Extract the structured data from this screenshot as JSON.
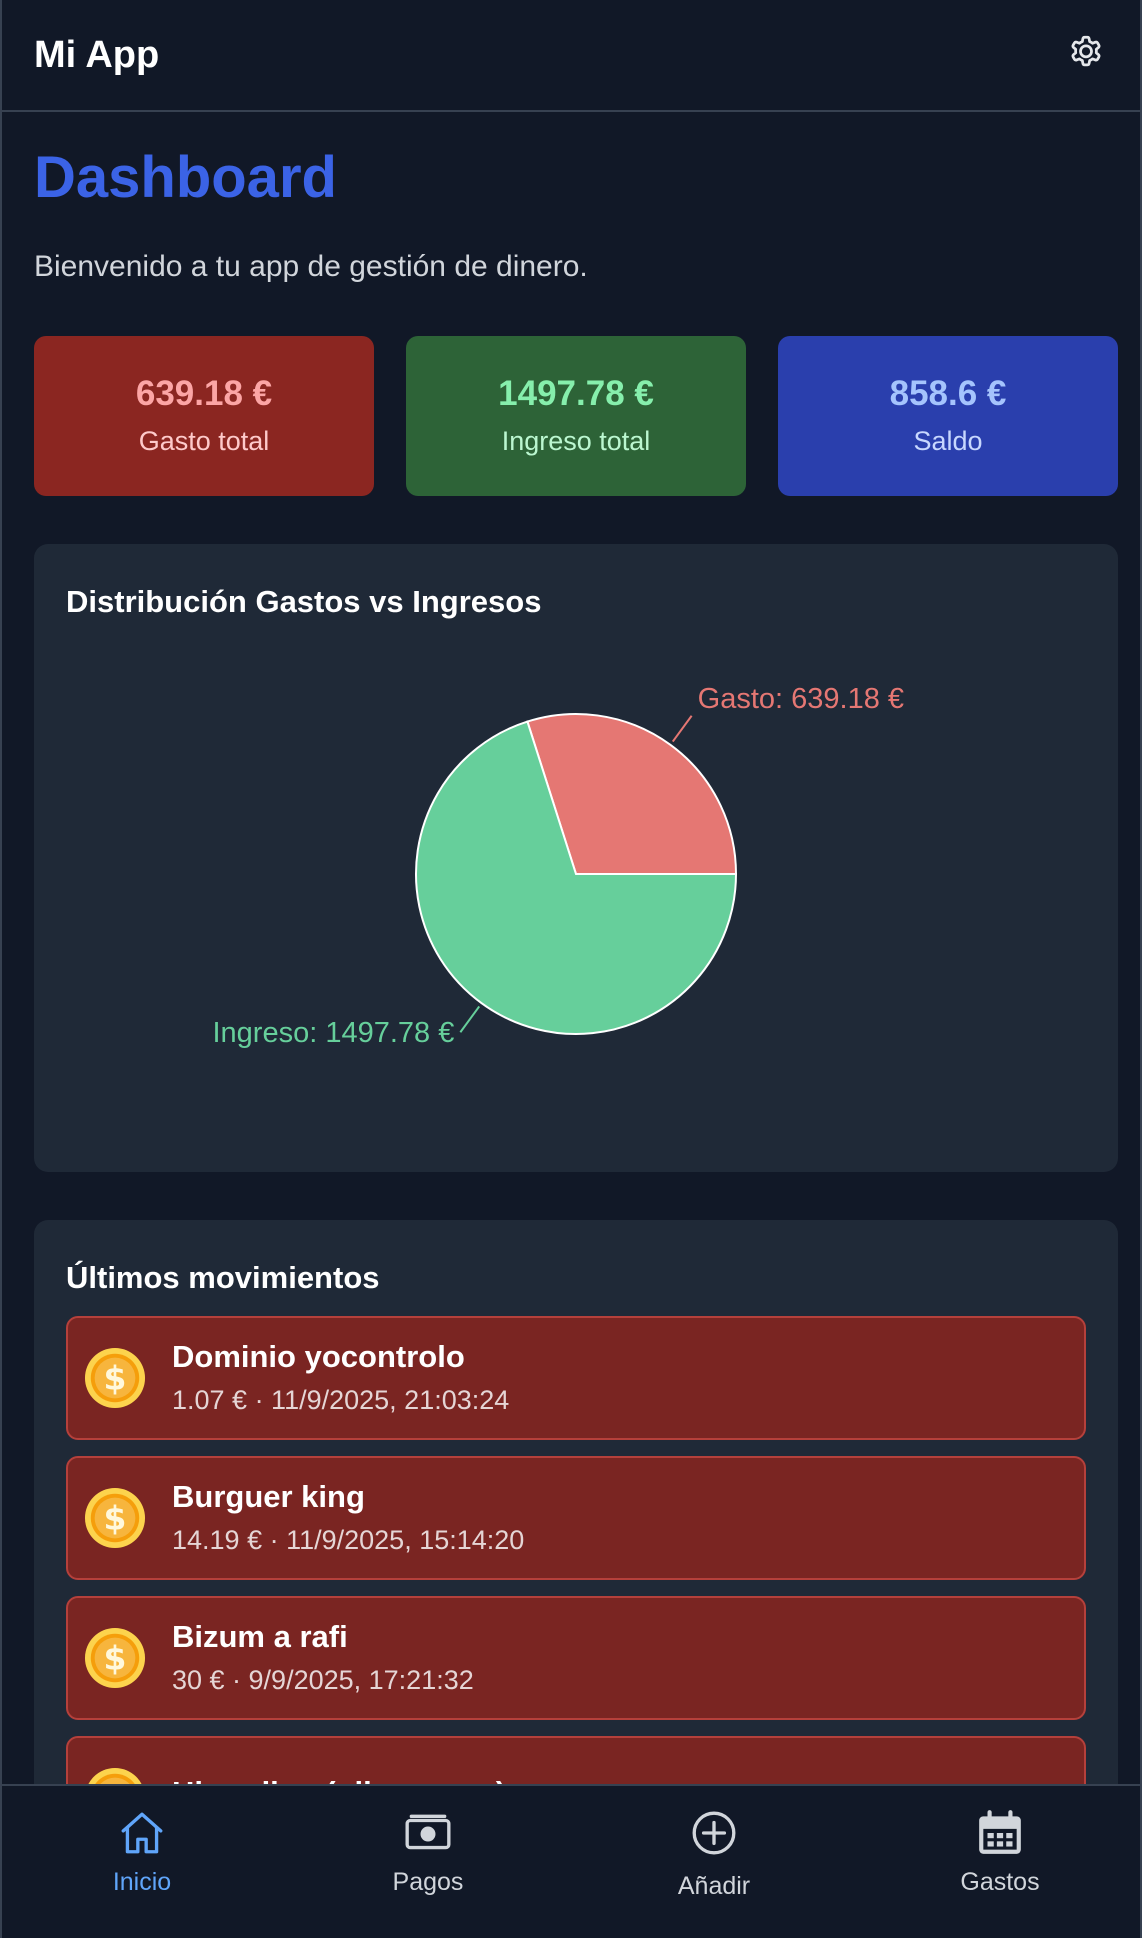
{
  "header": {
    "title": "Mi App",
    "settings_icon": "gear-icon"
  },
  "page": {
    "title": "Dashboard",
    "subtitle": "Bienvenido a tu app de gestión de dinero."
  },
  "stats": [
    {
      "value": "639.18 €",
      "label": "Gasto total",
      "color": "#8b2621"
    },
    {
      "value": "1497.78 €",
      "label": "Ingreso total",
      "color": "#2d6337"
    },
    {
      "value": "858.6 €",
      "label": "Saldo",
      "color": "#2a3fad"
    }
  ],
  "chart_card": {
    "title": "Distribución Gastos vs Ingresos"
  },
  "chart_data": {
    "type": "pie",
    "title": "",
    "slices": [
      {
        "label": "Gasto",
        "value": 639.18,
        "display": "Gasto: 639.18 €",
        "color": "#e57773"
      },
      {
        "label": "Ingreso",
        "value": 1497.78,
        "display": "Ingreso: 1497.78 €",
        "color": "#66cf9b"
      }
    ]
  },
  "movements": {
    "title": "Últimos movimientos",
    "items": [
      {
        "name": "Dominio yocontrolo",
        "meta": "1.07 € · 11/9/2025, 21:03:24",
        "icon": "coin-icon"
      },
      {
        "name": "Burguer king",
        "meta": "14.19 € · 11/9/2025, 15:14:20",
        "icon": "coin-icon"
      },
      {
        "name": "Bizum a rafi",
        "meta": "30 € · 9/9/2025, 17:21:32",
        "icon": "coin-icon"
      },
      {
        "name": "Hiperdino (pilas, agua)",
        "meta": "",
        "icon": "coin-icon"
      }
    ]
  },
  "nav": [
    {
      "label": "Inicio",
      "icon": "home-icon",
      "active": true
    },
    {
      "label": "Pagos",
      "icon": "banknote-icon",
      "active": false
    },
    {
      "label": "Añadir",
      "icon": "plus-circle-icon",
      "active": false
    },
    {
      "label": "Gastos",
      "icon": "calendar-icon",
      "active": false
    }
  ]
}
